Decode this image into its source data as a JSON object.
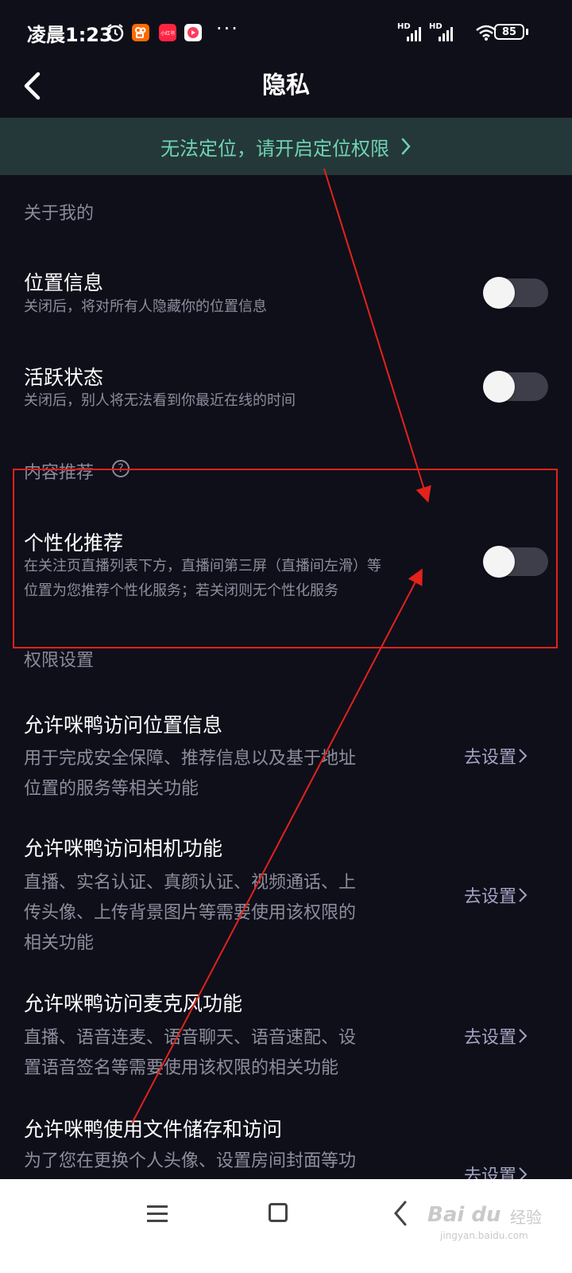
{
  "status_bar": {
    "time": "凌晨1:23",
    "more": "···",
    "network_labels": [
      "HD",
      "HD"
    ],
    "battery": "85",
    "app_icons": [
      {
        "name": "alarm-icon"
      },
      {
        "name": "kuaishou-icon",
        "color": "#ff6a00"
      },
      {
        "name": "xiaohongshu-icon",
        "color": "#ff2442",
        "label": "小红书"
      },
      {
        "name": "video-app-icon",
        "color": "#ff3b5c"
      }
    ]
  },
  "header": {
    "title": "隐私",
    "back_icon": "chevron-left-icon"
  },
  "banner": {
    "text": "无法定位，请开启定位权限",
    "color": "#6fd3b0",
    "background": "#24383a"
  },
  "sections": {
    "about_me": "关于我的",
    "content_recommend": "内容推荐",
    "permissions": "权限设置"
  },
  "toggles": [
    {
      "title": "位置信息",
      "desc": "关闭后，将对所有人隐藏你的位置信息",
      "on": false
    },
    {
      "title": "活跃状态",
      "desc": "关闭后，别人将无法看到你最近在线的时间",
      "on": false
    },
    {
      "title": "个性化推荐",
      "desc_line1": "在关注页直播列表下方，直播间第三屏（直播间左滑）等",
      "desc_line2": "位置为您推荐个性化服务；若关闭则无个性化服务",
      "on": false
    }
  ],
  "permissions": [
    {
      "title": "允许咪鸭访问位置信息",
      "desc": [
        "用于完成安全保障、推荐信息以及基于地址",
        "位置的服务等相关功能"
      ],
      "action": "去设置"
    },
    {
      "title": "允许咪鸭访问相机功能",
      "desc": [
        "直播、实名认证、真颜认证、视频通话、上",
        "传头像、上传背景图片等需要使用该权限的",
        "相关功能"
      ],
      "action": "去设置"
    },
    {
      "title": "允许咪鸭访问麦克风功能",
      "desc": [
        "直播、语音连麦、语音聊天、语音速配、设",
        "置语音签名等需要使用该权限的相关功能"
      ],
      "action": "去设置"
    },
    {
      "title": "允许咪鸭使用文件储存和访问",
      "desc": [
        "为了您在更换个人头像、设置房间封面等功"
      ],
      "action": "去设置"
    }
  ],
  "watermark": {
    "logo": "Bai du",
    "name": "经验",
    "url": "jingyan.baidu.com"
  },
  "colors": {
    "background": "#0f0f1a",
    "annotation": "#e3221b",
    "toggle_off_track": "#3e3e4a",
    "link": "#a3a3c4"
  }
}
